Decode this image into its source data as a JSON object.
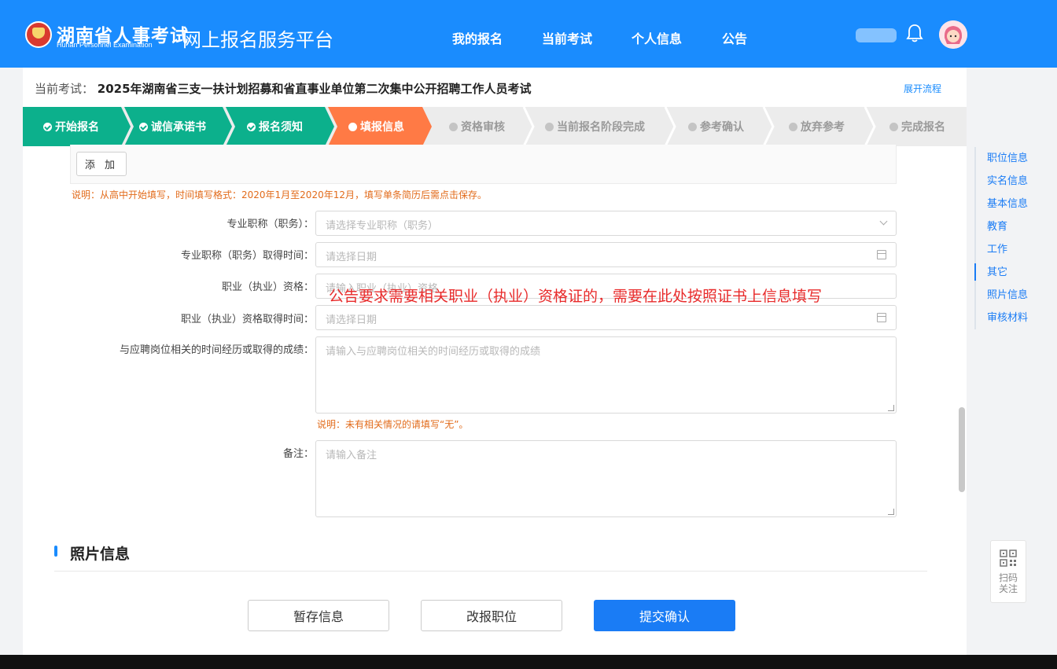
{
  "header": {
    "logo_title": "湖南省人事考试",
    "logo_sub": "Hunan Personnel Examination",
    "platform_title": "网上报名服务平台",
    "nav": [
      "我的报名",
      "当前考试",
      "个人信息",
      "公告"
    ],
    "brand_color": "#1a8cfe"
  },
  "exam": {
    "label": "当前考试：",
    "name": "2025年湖南省三支一扶计划招募和省直事业单位第二次集中公开招聘工作人员考试",
    "expand_link": "展开流程"
  },
  "steps": [
    {
      "label": "开始报名",
      "status": "done",
      "color": "#0cb08c"
    },
    {
      "label": "诚信承诺书",
      "status": "done",
      "color": "#0cb08c"
    },
    {
      "label": "报名须知",
      "status": "done",
      "color": "#0cb08c"
    },
    {
      "label": "填报信息",
      "status": "current",
      "color": "#ff7a45"
    },
    {
      "label": "资格审核",
      "status": "todo"
    },
    {
      "label": "当前报名阶段完成",
      "status": "todo"
    },
    {
      "label": "参考确认",
      "status": "todo"
    },
    {
      "label": "放弃参考",
      "status": "todo"
    },
    {
      "label": "完成报名",
      "status": "todo"
    }
  ],
  "form": {
    "add_button": "添 加",
    "resume_note": "说明：从高中开始填写，时间填写格式：2020年1月至2020年12月，填写单条简历后需点击保存。",
    "title_label": "专业职称（职务）：",
    "title_placeholder": "请选择专业职称（职务）",
    "title_date_label": "专业职称（职务）取得时间：",
    "title_date_placeholder": "请选择日期",
    "qual_label": "职业（执业）资格：",
    "qual_placeholder": "请输入职业（执业）资格",
    "qual_date_label": "职业（执业）资格取得时间：",
    "qual_date_placeholder": "请选择日期",
    "exp_label": "与应聘岗位相关的时间经历或取得的成绩：",
    "exp_placeholder": "请输入与应聘岗位相关的时间经历或取得的成绩",
    "exp_note": "说明：未有相关情况的请填写“无”。",
    "remark_label": "备注：",
    "remark_placeholder": "请输入备注",
    "annotation": "公告要求需要相关职业（执业）资格证的，需要在此处按照证书上信息填写"
  },
  "section": {
    "photo_title": "照片信息"
  },
  "actions": {
    "save_draft": "暂存信息",
    "change_position": "改报职位",
    "submit": "提交确认"
  },
  "side_nav": {
    "items": [
      "职位信息",
      "实名信息",
      "基本信息",
      "教育",
      "工作",
      "其它",
      "照片信息",
      "审核材料"
    ],
    "active": "其它"
  },
  "qr": {
    "text_line1": "扫码",
    "text_line2": "关注"
  }
}
